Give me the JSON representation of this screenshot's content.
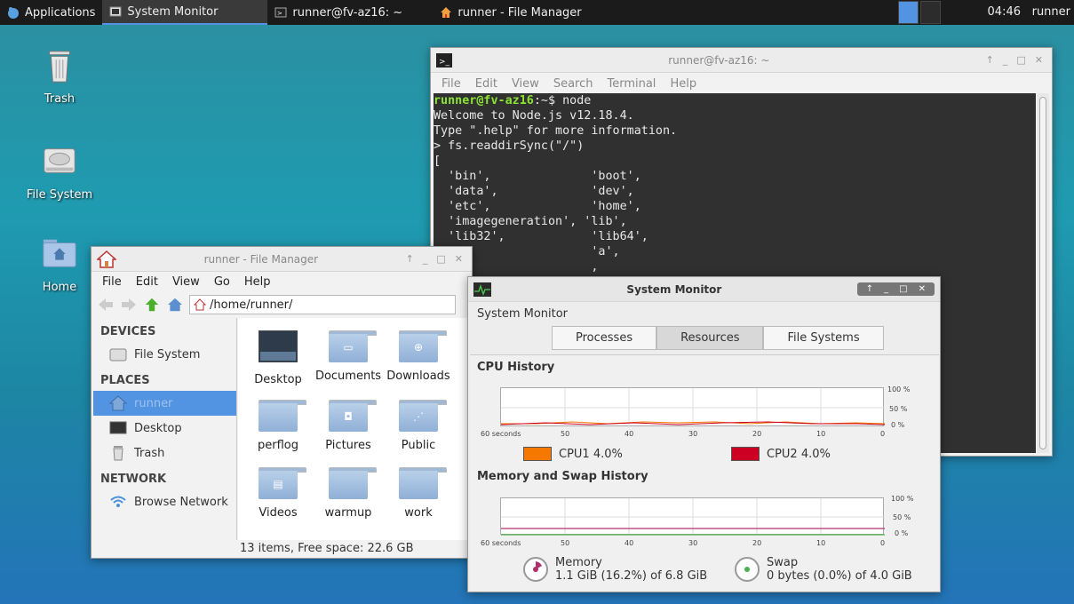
{
  "panel": {
    "apps_label": "Applications",
    "tasks": [
      {
        "label": "System Monitor"
      },
      {
        "label": "runner@fv-az16: ~"
      },
      {
        "label": "runner - File Manager"
      }
    ],
    "clock": "04:46",
    "user": "runner"
  },
  "desktop": {
    "icons": [
      {
        "label": "Trash"
      },
      {
        "label": "File System"
      },
      {
        "label": "Home"
      }
    ]
  },
  "terminal": {
    "title": "runner@fv-az16: ~",
    "menu": [
      "File",
      "Edit",
      "View",
      "Search",
      "Terminal",
      "Help"
    ],
    "prompt_user": "runner@fv-az16",
    "prompt_rest": ":~$ node",
    "lines": [
      "Welcome to Node.js v12.18.4.",
      "Type \".help\" for more information.",
      "> fs.readdirSync(\"/\")",
      "[",
      "  'bin',              'boot',",
      "  'data',             'dev',",
      "  'etc',              'home',",
      "  'imagegeneration', 'lib',",
      "  'lib32',            'lib64',",
      "                      'a',",
      "                      ,"
    ]
  },
  "filemanager": {
    "title": "runner - File Manager",
    "menu": [
      "File",
      "Edit",
      "View",
      "Go",
      "Help"
    ],
    "path": "/home/runner/",
    "devices_header": "DEVICES",
    "places_header": "PLACES",
    "network_header": "NETWORK",
    "devices": [
      "File System"
    ],
    "places": [
      "runner",
      "Desktop",
      "Trash"
    ],
    "network": [
      "Browse Network"
    ],
    "items": [
      "Desktop",
      "Documents",
      "Downloads",
      "perflog",
      "Pictures",
      "Public",
      "Videos",
      "warmup",
      "work"
    ],
    "status": "13 items, Free space: 22.6 GB"
  },
  "sysmon": {
    "title": "System Monitor",
    "header": "System Monitor",
    "tabs": [
      "Processes",
      "Resources",
      "File Systems"
    ],
    "cpu_title": "CPU History",
    "mem_title": "Memory and Swap History",
    "x_ticks": [
      "60 seconds",
      "50",
      "40",
      "30",
      "20",
      "10",
      "0"
    ],
    "y_ticks": [
      "100 %",
      "50 %",
      "0 %"
    ],
    "cpu1_label": "CPU1  4.0%",
    "cpu2_label": "CPU2  4.0%",
    "cpu1_color": "#f57900",
    "cpu2_color": "#cc0022",
    "memory_label": "Memory",
    "memory_value": "1.1 GiB (16.2%) of 6.8 GiB",
    "swap_label": "Swap",
    "swap_value": "0 bytes (0.0%) of 4.0 GiB"
  }
}
